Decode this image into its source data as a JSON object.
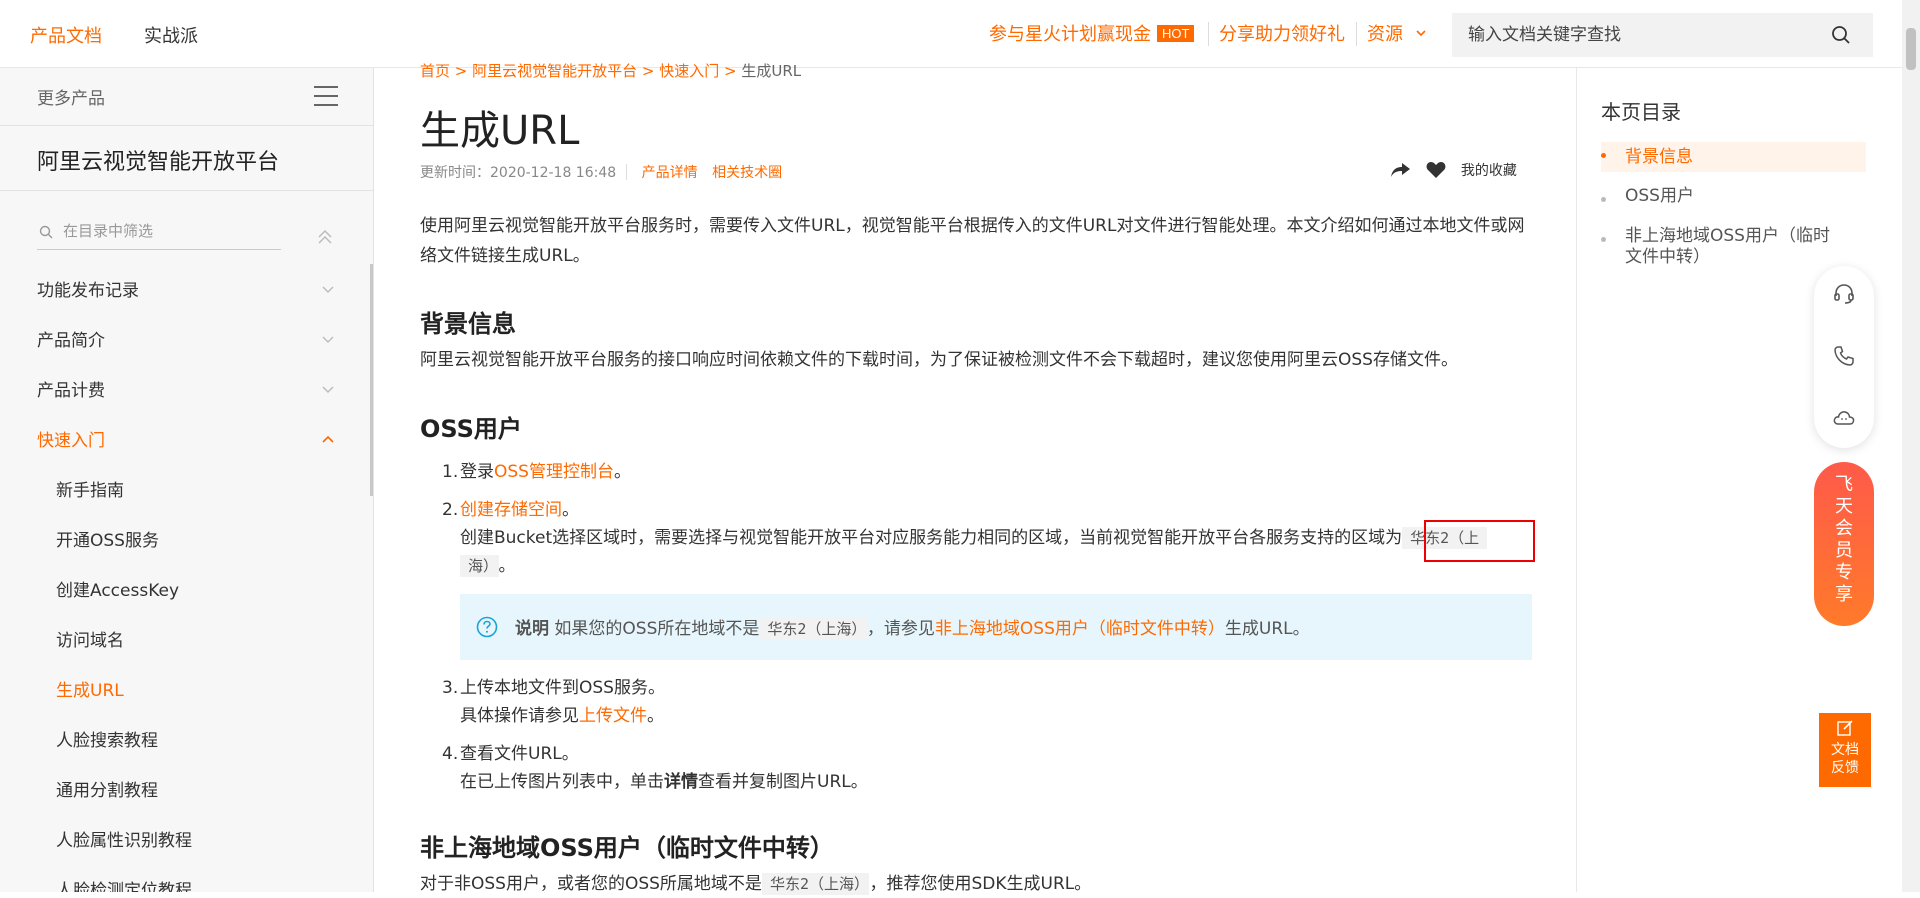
{
  "topnav": {
    "docs": "产品文档",
    "practice": "实战派",
    "spark": "参与星火计划赢现金",
    "hot": "HOT",
    "share": "分享助力领好礼",
    "resources": "资源",
    "search_placeholder": "输入文档关键字查找"
  },
  "sidebar": {
    "more_products": "更多产品",
    "platform_title": "阿里云视觉智能开放平台",
    "filter_placeholder": "在目录中筛选",
    "items": [
      {
        "label": "功能发布记录"
      },
      {
        "label": "产品简介"
      },
      {
        "label": "产品计费"
      },
      {
        "label": "快速入门"
      }
    ],
    "subitems": [
      {
        "label": "新手指南"
      },
      {
        "label": "开通OSS服务"
      },
      {
        "label": "创建AccessKey"
      },
      {
        "label": "访问域名"
      },
      {
        "label": "生成URL"
      },
      {
        "label": "人脸搜索教程"
      },
      {
        "label": "通用分割教程"
      },
      {
        "label": "人脸属性识别教程"
      },
      {
        "label": "人脸检测定位教程"
      }
    ]
  },
  "breadcrumb": {
    "home": "首页",
    "platform": "阿里云视觉智能开放平台",
    "quickstart": "快速入门",
    "current": "生成URL"
  },
  "page": {
    "title": "生成URL",
    "updated": "更新时间：2020-12-18 16:48",
    "product_detail": "产品详情",
    "tech_circle": "相关技术圈",
    "favorites": "我的收藏",
    "intro": "使用阿里云视觉智能开放平台服务时，需要传入文件URL，视觉智能平台根据传入的文件URL对文件进行智能处理。本文介绍如何通过本地文件或网络文件链接生成URL。",
    "sec_background": "背景信息",
    "background_text": "阿里云视觉智能开放平台服务的接口响应时间依赖文件的下载时间，为了保证被检测文件不会下载超时，建议您使用阿里云OSS存储文件。",
    "sec_oss": "OSS用户",
    "step1_num": "1.",
    "step1_pre": "登录",
    "step1_link": "OSS管理控制台",
    "step1_post": "。",
    "step2_num": "2.",
    "step2_link": "创建存储空间",
    "step2_post": "。",
    "step2_desc": "创建Bucket选择区域时，需要选择与视觉智能开放平台对应服务能力相同的区域，当前视觉智能开放平台各服务支持的区域为",
    "step2_code_a": "华东2（上",
    "step2_code_b": "海）",
    "step2_end": "。",
    "note_label": "说明",
    "note_pre": "如果您的OSS所在地域不是",
    "note_code": "华东2（上海）",
    "note_mid": "，请参见",
    "note_link": "非上海地域OSS用户（临时文件中转）",
    "note_post": "生成URL。",
    "step3_num": "3.",
    "step3_text": "上传本地文件到OSS服务。",
    "step3_pre": "具体操作请参见",
    "step3_link": "上传文件",
    "step3_post": "。",
    "step4_num": "4.",
    "step4_text": "查看文件URL。",
    "step4_pre": "在已上传图片列表中，单击",
    "step4_bold": "详情",
    "step4_post": "查看并复制图片URL。",
    "sec_non_shanghai": "非上海地域OSS用户（临时文件中转）",
    "last_pre": "对于非OSS用户，或者您的OSS所属地域不是",
    "last_code": "华东2（上海）",
    "last_post": "，推荐您使用SDK生成URL。"
  },
  "toc": {
    "title": "本页目录",
    "items": [
      {
        "label": "背景信息"
      },
      {
        "label": "OSS用户"
      },
      {
        "label": "非上海地域OSS用户（临时文件中转）"
      }
    ]
  },
  "float": {
    "member": "飞天会员专享",
    "feedback_line1": "文档",
    "feedback_line2": "反馈"
  }
}
